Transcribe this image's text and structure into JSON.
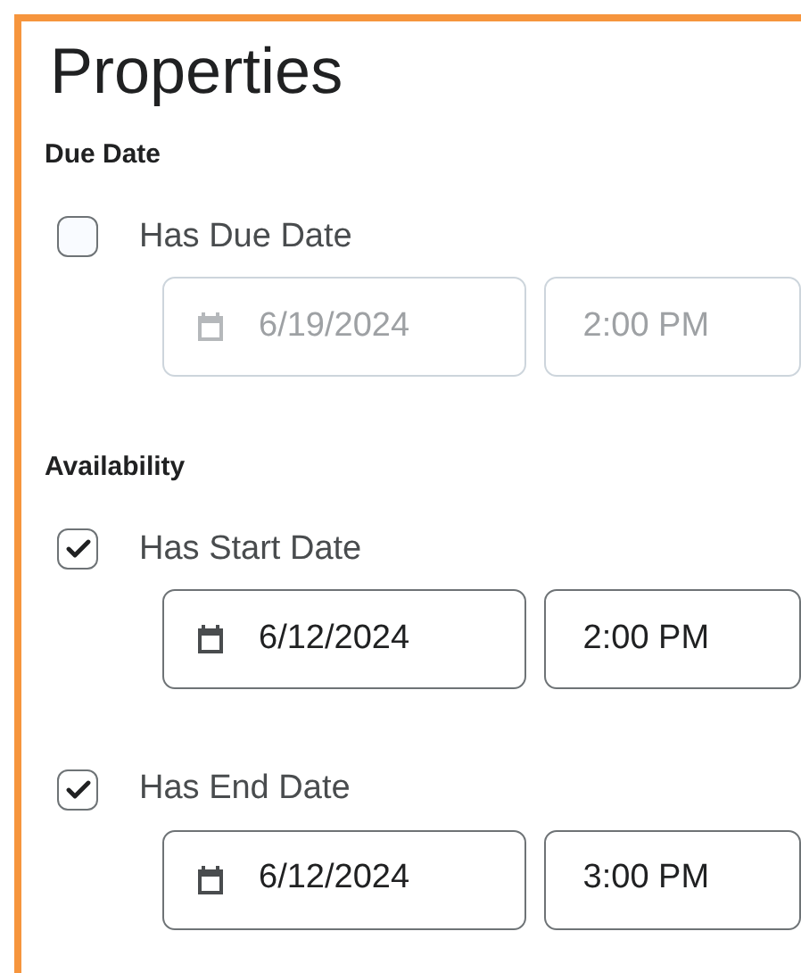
{
  "title": "Properties",
  "sections": [
    {
      "heading": "Due Date",
      "options": [
        {
          "label": "Has Due Date",
          "checked": false,
          "date": "6/19/2024",
          "time": "2:00 PM"
        }
      ]
    },
    {
      "heading": "Availability",
      "options": [
        {
          "label": "Has Start Date",
          "checked": true,
          "date": "6/12/2024",
          "time": "2:00 PM"
        },
        {
          "label": "Has End Date",
          "checked": true,
          "date": "6/12/2024",
          "time": "3:00 PM"
        }
      ]
    }
  ]
}
